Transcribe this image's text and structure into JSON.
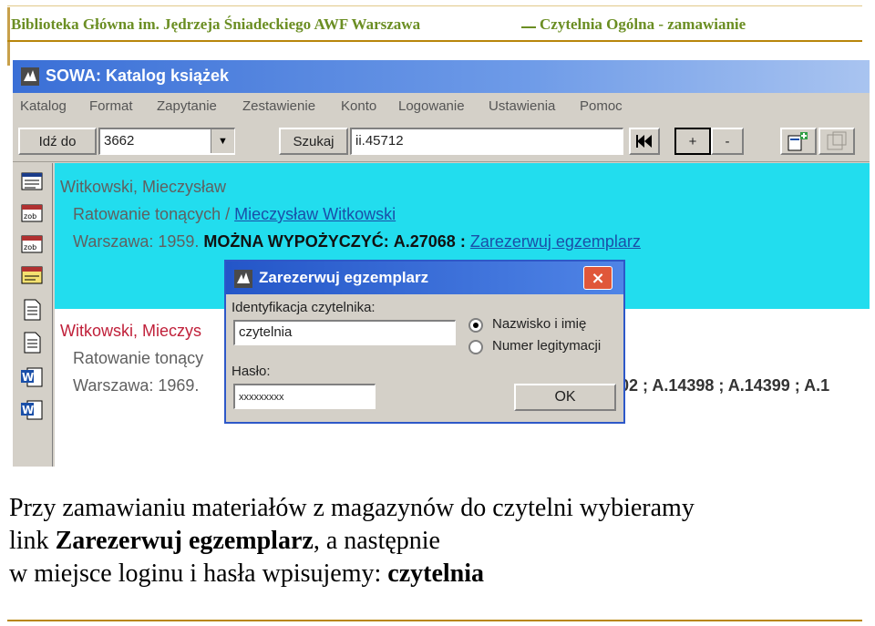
{
  "slide": {
    "header_left": "Biblioteka Główna im. Jędrzeja Śniadeckiego AWF Warszawa",
    "header_right": "Czytelnia Ogólna - zamawianie"
  },
  "app": {
    "title": "SOWA: Katalog książek",
    "menu": [
      "Katalog",
      "Format",
      "Zapytanie",
      "Zestawienie",
      "Konto",
      "Logowanie",
      "Ustawienia",
      "Pomoc"
    ],
    "toolbar": {
      "goto_label": "Idź do",
      "goto_value": "3662",
      "search_label": "Szukaj",
      "search_value": "ii.45712",
      "plus_label": "+",
      "minus_label": "-"
    },
    "records": {
      "first": {
        "author": "Witkowski, Mieczysław",
        "title": "Ratowanie tonących /",
        "author_link": "Mieczysław Witkowski",
        "imprint": "Warszawa: 1959.",
        "availability": "MOŻNA WYPOŻYCZYĆ:",
        "signature": "A.27068 :",
        "reserve_link": "Zarezerwuj egzemplarz"
      },
      "second": {
        "author": "Witkowski, Mieczys",
        "title": "Ratowanie tonący",
        "imprint": "Warszawa: 1969.",
        "signatures": "02 ; A.14398 ; A.14399 ; A.1"
      }
    },
    "dialog": {
      "title": "Zarezerwuj egzemplarz",
      "close": "×",
      "id_label": "Identyfikacja czytelnika:",
      "id_value": "czytelnia",
      "radio_name": "Nazwisko i imię",
      "radio_card": "Numer legitymacji",
      "password_label": "Hasło:",
      "password_value": "xxxxxxxxx",
      "ok": "OK"
    }
  },
  "caption": {
    "line1": "Przy zamawianiu materiałów z magazynów do czytelni wybieramy",
    "line2_pre": "link ",
    "line2_bold": "Zarezerwuj egzemplarz",
    "line2_post": ", a następnie",
    "line3_pre": "w miejsce loginu i hasła wpisujemy: ",
    "line3_bold": "czytelnia"
  },
  "colors": {
    "header_text": "#6b8e23",
    "rule": "#b8860b",
    "record_bg": "#22ddee",
    "link": "#1a4fa8"
  }
}
